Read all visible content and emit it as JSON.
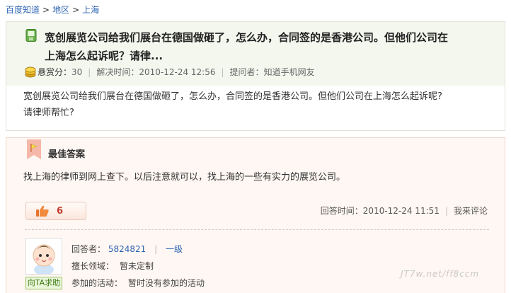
{
  "breadcrumb": {
    "items": [
      "百度知道",
      "地区",
      "上海"
    ],
    "separator": ">"
  },
  "question": {
    "title_line1": "宽创展览公司给我们展台在德国做砸了，怎么办，合同签的是香港公司。但他们公司在",
    "title_line2": "上海怎么起诉呢？请律...",
    "reward_label": "悬赏分：",
    "reward_value": "30",
    "resolved_label": "解决时间：",
    "resolved_time": "2010-12-24 12:56",
    "asker_label": "提问者：",
    "asker": "知道手机网友",
    "body_line1": "宽创展览公司给我们展台在德国做砸了，怎么办，合同签的是香港公司。但他们公司在上海怎么起诉呢?",
    "body_line2": "请律师帮忙?"
  },
  "answer": {
    "heading": "最佳答案",
    "body": "找上海的律师到网上查下。以后注意就可以，找上海的一些有实力的展览公司。",
    "likes": "6",
    "answer_time_label": "回答时间：",
    "answer_time": "2010-12-24 11:51",
    "comment_label": "我来评论",
    "answerer_label": "回答者：",
    "answerer": "5824821",
    "level": "一级",
    "expertise_label": "擅长领域：",
    "expertise": "暂未定制",
    "activities_label": "参加的活动：",
    "activities": "暂时没有参加的活动",
    "help_button": "向TA求助"
  },
  "watermark": "JT7w.net/ff8ccm"
}
